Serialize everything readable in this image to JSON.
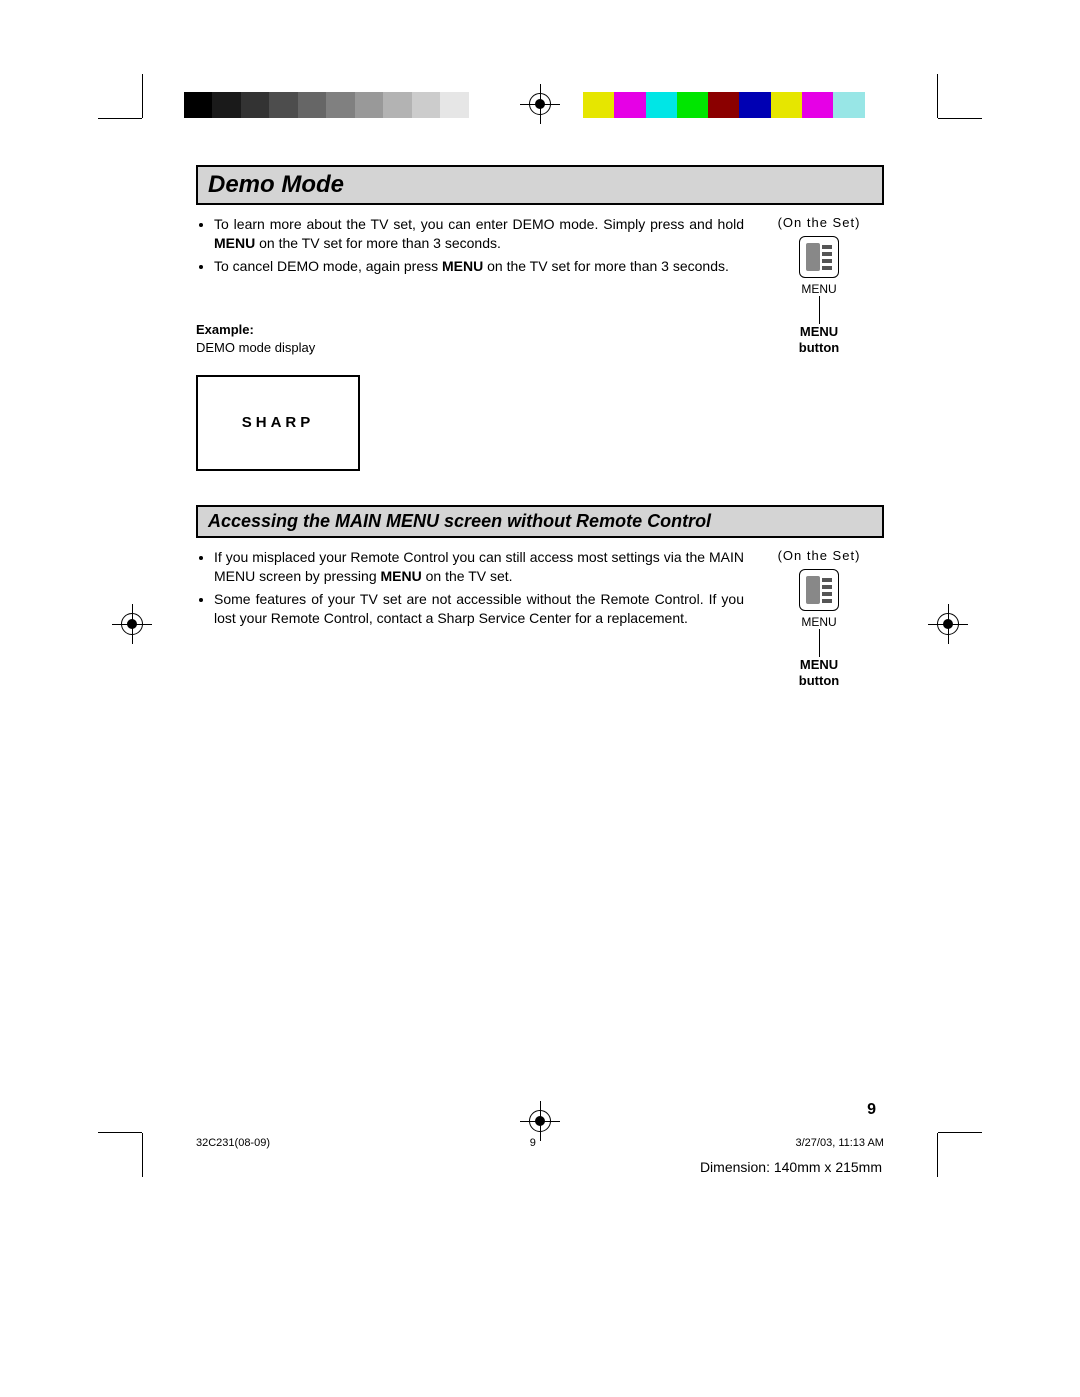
{
  "section1": {
    "title": "Demo Mode",
    "bullet1_a": "To learn more about the TV set, you can enter DEMO mode. Simply press and hold ",
    "bullet1_bold": "MENU",
    "bullet1_b": " on the TV set for more than 3 seconds.",
    "bullet2_a": "To cancel DEMO mode, again press ",
    "bullet2_bold": "MENU",
    "bullet2_b": " on the TV set for more than 3 seconds.",
    "example_label": "Example:",
    "example_desc": "DEMO mode display",
    "sharp_logo_text": "SHARP"
  },
  "section2": {
    "title": "Accessing the MAIN MENU screen without Remote Control",
    "bullet1_a": "If you misplaced your Remote Control you can still access most settings via the MAIN MENU screen by pressing ",
    "bullet1_bold": "MENU",
    "bullet1_b": " on the TV set.",
    "bullet2": "Some features of your TV set are not accessible without the Remote Control. If you lost your Remote Control, contact a Sharp Service Center for a replacement."
  },
  "icon_block": {
    "on_set": "(On the Set)",
    "under_icon": "MENU",
    "button_label_line1": "MENU",
    "button_label_line2": "button"
  },
  "page_number": "9",
  "footer": {
    "doc_id": "32C231(08-09)",
    "page": "9",
    "timestamp": "3/27/03, 11:13 AM"
  },
  "dimension": "Dimension: 140mm x 215mm",
  "colors": {
    "grays": [
      "#000000",
      "#1a1a1a",
      "#333333",
      "#4d4d4d",
      "#666666",
      "#808080",
      "#999999",
      "#b3b3b3",
      "#cccccc",
      "#e6e6e6",
      "#ffffff"
    ],
    "hues": [
      "#e6e600",
      "#e600e6",
      "#00e6e6",
      "#00e600",
      "#8b0000",
      "#0000b3",
      "#e6e600",
      "#e600e6",
      "#98e6e6",
      "#ffffff"
    ]
  }
}
